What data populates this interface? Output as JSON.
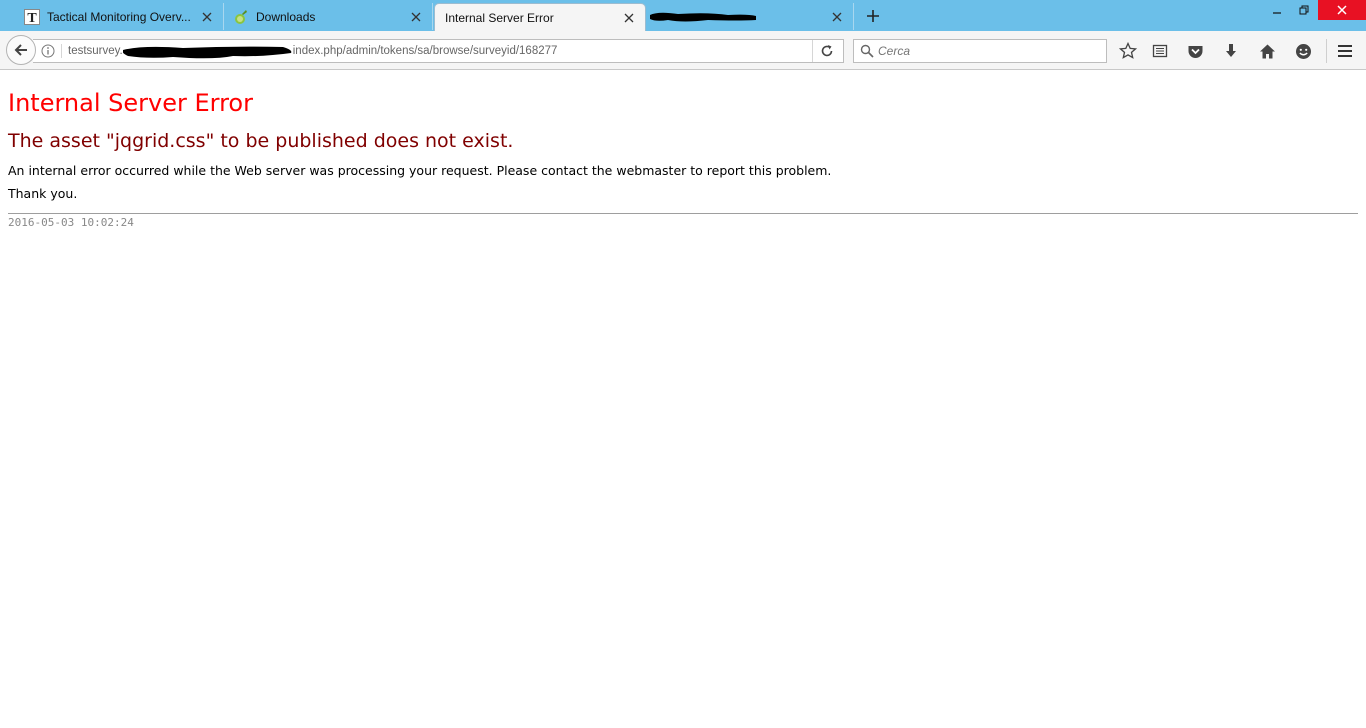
{
  "tabs": [
    {
      "label": "Tactical Monitoring Overv...",
      "favicon": "letter-t-icon",
      "active": false
    },
    {
      "label": "Downloads",
      "favicon": "limesurvey-icon",
      "active": false
    },
    {
      "label": "Internal Server Error",
      "favicon": "none",
      "active": true
    },
    {
      "label": "",
      "favicon": "redacted",
      "active": false
    }
  ],
  "url": {
    "host": "testsurvey.",
    "path": "index.php/admin/tokens/sa/browse/surveyid/168277"
  },
  "search": {
    "placeholder": "Cerca"
  },
  "page": {
    "title": "Internal Server Error",
    "message": "The asset \"jqgrid.css\" to be published does not exist.",
    "description": "An internal error occurred while the Web server was processing your request. Please contact the webmaster to report this problem.",
    "thanks": "Thank you.",
    "timestamp": "2016-05-03 10:02:24"
  },
  "colors": {
    "tabstrip": "#6bbfe9",
    "title": "#ff0000",
    "message": "#800000",
    "close_button": "#e81123"
  }
}
